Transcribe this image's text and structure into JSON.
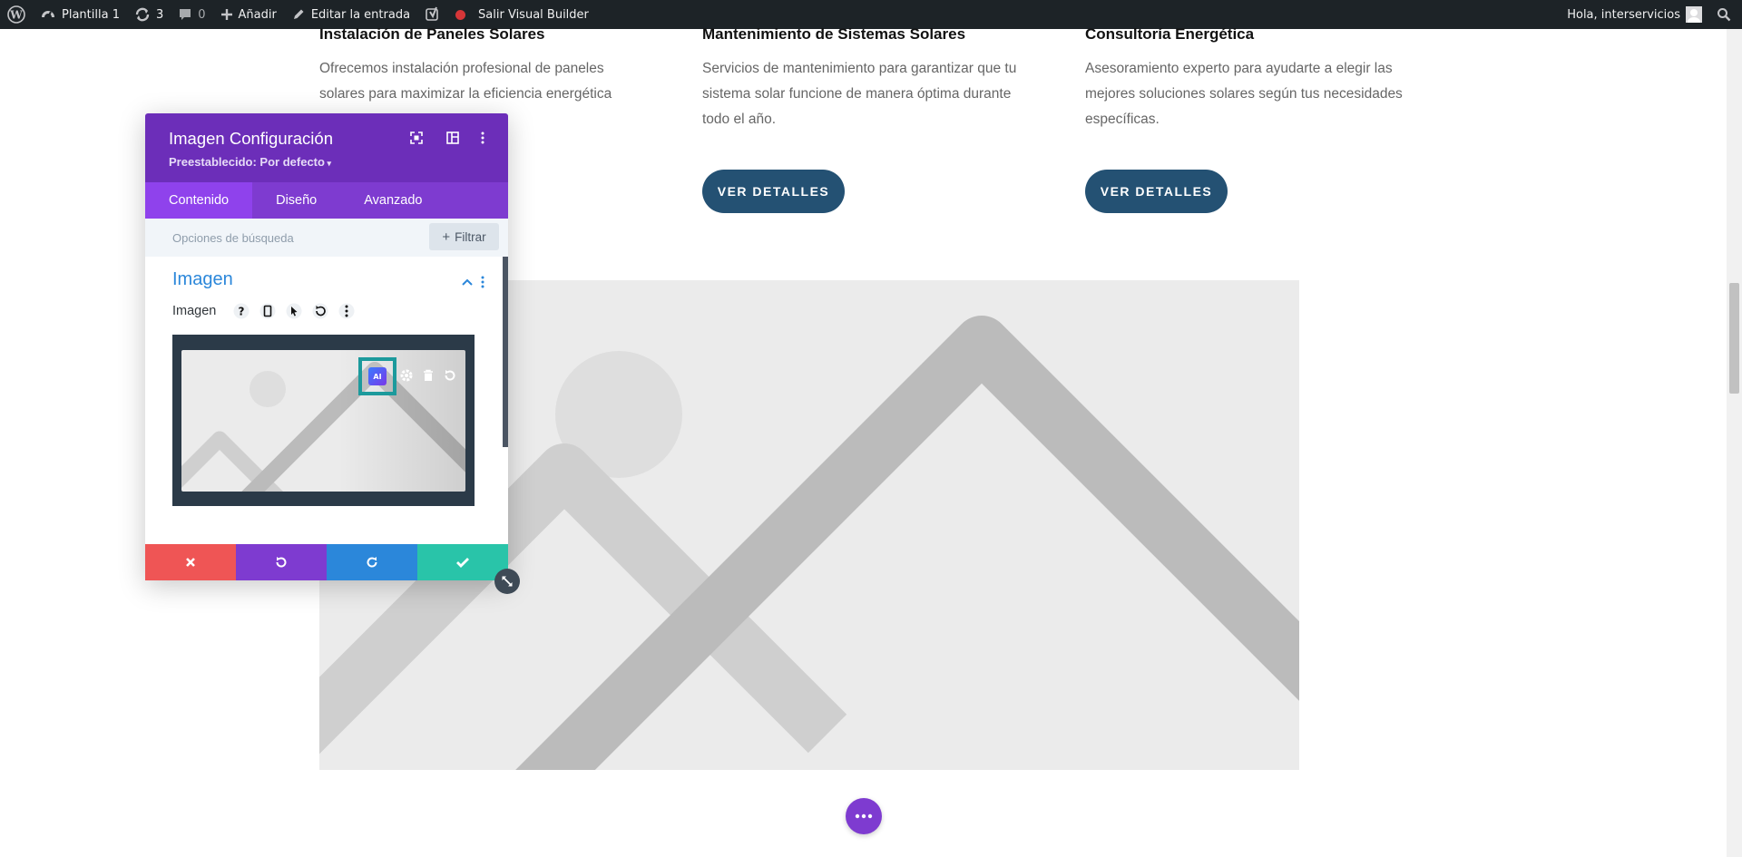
{
  "admin_bar": {
    "site_name": "Plantilla 1",
    "updates_count": "3",
    "comments_count": "0",
    "add_new": "Añadir",
    "edit_post": "Editar la entrada",
    "exit_builder": "Salir Visual Builder",
    "greeting": "Hola, interservicios"
  },
  "services": [
    {
      "title": "Instalación de Paneles Solares",
      "description": "Ofrecemos instalación profesional de paneles solares para maximizar la eficiencia energética"
    },
    {
      "title": "Mantenimiento de Sistemas Solares",
      "description": "Servicios de mantenimiento para garantizar que tu sistema solar funcione de manera óptima durante todo el año.",
      "button": "VER DETALLES"
    },
    {
      "title": "Consultoría Energética",
      "description": "Asesoramiento experto para ayudarte a elegir las mejores soluciones solares según tus necesidades específicas.",
      "button": "VER DETALLES"
    }
  ],
  "modal": {
    "title": "Imagen Configuración",
    "preset": "Preestablecido: Por defecto",
    "tabs": [
      {
        "label": "Contenido",
        "active": true
      },
      {
        "label": "Diseño",
        "active": false
      },
      {
        "label": "Avanzado",
        "active": false
      }
    ],
    "search_placeholder": "Opciones de búsqueda",
    "filter_label": "Filtrar",
    "section_title": "Imagen",
    "field_label": "Imagen",
    "ai_badge": "AI"
  },
  "colors": {
    "admin_bar": "#1d2327",
    "modal_header": "#6c2eb9",
    "modal_tabs": "#7e3bd0",
    "tab_active": "#8f42ec",
    "detail_button": "#245173",
    "discard": "#ef5555",
    "undo": "#7e3bd0",
    "redo": "#2b87da",
    "save": "#29c4a9",
    "highlight": "#1c9a9c"
  }
}
